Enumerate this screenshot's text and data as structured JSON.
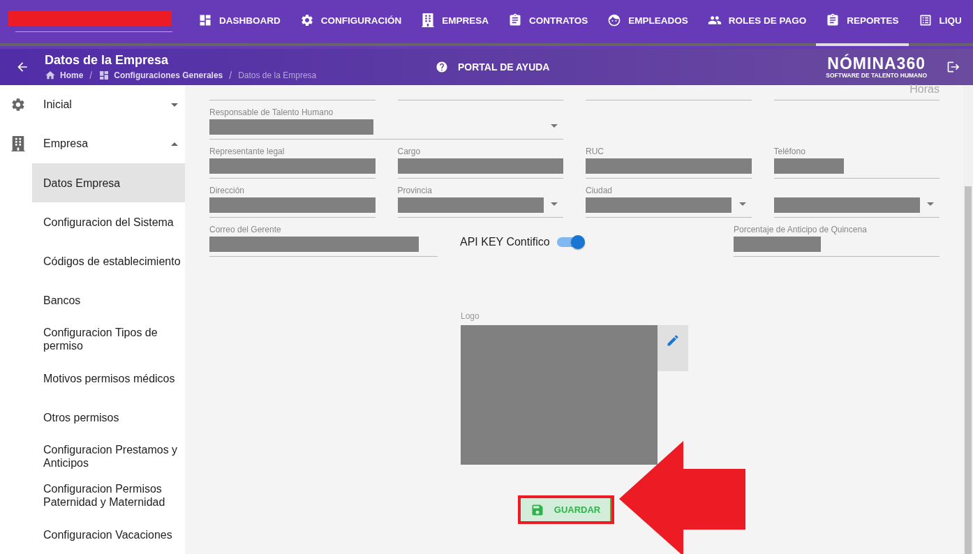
{
  "nav": [
    {
      "label": "DASHBOARD",
      "selected": false
    },
    {
      "label": "CONFIGURACIÓN",
      "selected": false
    },
    {
      "label": "EMPRESA",
      "selected": false
    },
    {
      "label": "CONTRATOS",
      "selected": false
    },
    {
      "label": "EMPLEADOS",
      "selected": false
    },
    {
      "label": "ROLES DE PAGO",
      "selected": false
    },
    {
      "label": "REPORTES",
      "selected": true
    },
    {
      "label": "LIQU",
      "selected": false
    }
  ],
  "header": {
    "title": "Datos de la Empresa",
    "breadcrumbs": [
      {
        "label": "Home"
      },
      {
        "label": "Configuraciones Generales"
      },
      {
        "label": "Datos de la Empresa"
      }
    ],
    "separator": "/",
    "help": "PORTAL DE AYUDA",
    "brand": "NÓMINA360",
    "brand_tagline": "SOFTWARE DE TALENTO HUMANO"
  },
  "sidebar": [
    {
      "label": "Inicial",
      "expanded": false
    },
    {
      "label": "Empresa",
      "expanded": true,
      "children": [
        {
          "label": "Datos Empresa",
          "selected": true
        },
        {
          "label": "Configuracion del Sistema",
          "selected": false
        },
        {
          "label": "Códigos de establecimiento",
          "selected": false
        },
        {
          "label": "Bancos",
          "selected": false
        },
        {
          "label": "Configuracion Tipos de permiso",
          "selected": false
        },
        {
          "label": "Motivos permisos médicos",
          "selected": false
        },
        {
          "label": "Otros permisos",
          "selected": false
        },
        {
          "label": "Configuracion Prestamos y Anticipos",
          "selected": false
        },
        {
          "label": "Configuracion Permisos Paternidad y Maternidad",
          "selected": false
        },
        {
          "label": "Configuracion Vacaciones",
          "selected": false
        }
      ]
    }
  ],
  "form": {
    "top_suffix": "Horas",
    "rows": [
      [
        {
          "label": "Responsable de Talento Humano",
          "kind": "select"
        }
      ],
      [
        {
          "label": "Representante legal",
          "kind": "text"
        },
        {
          "label": "Cargo",
          "kind": "text"
        },
        {
          "label": "RUC",
          "kind": "text"
        },
        {
          "label": "Teléfono",
          "kind": "text"
        }
      ],
      [
        {
          "label": "Dirección",
          "kind": "text"
        },
        {
          "label": "Provincia",
          "kind": "select"
        },
        {
          "label": "Ciudad",
          "kind": "select"
        },
        {
          "kind": "select"
        }
      ]
    ],
    "manager_email": {
      "label": "Correo del Gerente"
    },
    "toggle": {
      "label": "API KEY Contifico",
      "on": true
    },
    "advance": {
      "label": "Porcentaje de Anticipo de Quincena"
    },
    "logo_label": "Logo",
    "save": "GUARDAR"
  }
}
